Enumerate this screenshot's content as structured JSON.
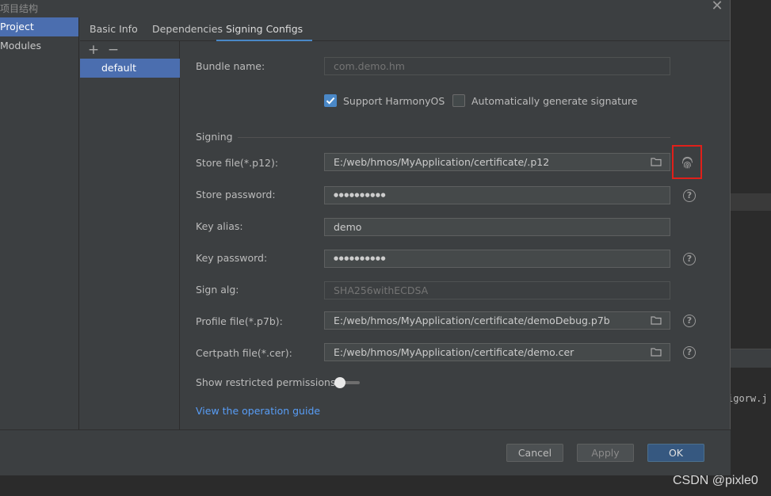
{
  "dialog": {
    "title": "项目结构",
    "close_label": "✕"
  },
  "nav": {
    "items": [
      {
        "label": "Project",
        "selected": true
      },
      {
        "label": "Modules",
        "selected": false
      }
    ]
  },
  "tabs": [
    {
      "label": "Basic Info"
    },
    {
      "label": "Dependencies"
    },
    {
      "label": "Signing Configs",
      "active": true
    }
  ],
  "configs": {
    "add_label": "+",
    "remove_label": "−",
    "items": [
      {
        "label": "default",
        "selected": true
      }
    ]
  },
  "form": {
    "bundle_name": {
      "label": "Bundle name:",
      "value": "com.demo.hm"
    },
    "support_harmony": {
      "label": "Support HarmonyOS",
      "checked": true
    },
    "auto_sign": {
      "label": "Automatically generate signature",
      "checked": false
    },
    "section_label": "Signing",
    "store_file": {
      "label": "Store file(*.p12):",
      "value": "E:/web/hmos/MyApplication/certificate/.p12"
    },
    "store_password": {
      "label": "Store password:",
      "value": "●●●●●●●●●●"
    },
    "key_alias": {
      "label": "Key alias:",
      "value": "demo"
    },
    "key_password": {
      "label": "Key password:",
      "value": "●●●●●●●●●●"
    },
    "sign_alg": {
      "label": "Sign alg:",
      "value": "SHA256withECDSA"
    },
    "profile_file": {
      "label": "Profile file(*.p7b):",
      "value": "E:/web/hmos/MyApplication/certificate/demoDebug.p7b"
    },
    "certpath_file": {
      "label": "Certpath file(*.cer):",
      "value": "E:/web/hmos/MyApplication/certificate/demo.cer"
    },
    "show_restricted": {
      "label": "Show restricted permissions",
      "on": false
    },
    "guide_link": "View the operation guide",
    "help_glyph": "?"
  },
  "footer": {
    "cancel": "Cancel",
    "apply": "Apply",
    "ok": "OK"
  },
  "background": {
    "code_snippet": "igorw.j",
    "watermark": "CSDN @pixle0"
  },
  "colors": {
    "accent": "#4a88c7",
    "selection": "#4b6eaf",
    "highlight_box": "#e0201a",
    "link": "#589df6"
  },
  "icons": {
    "folder": "folder-icon",
    "fingerprint": "fingerprint-icon",
    "help": "help-icon",
    "close": "close-icon"
  }
}
